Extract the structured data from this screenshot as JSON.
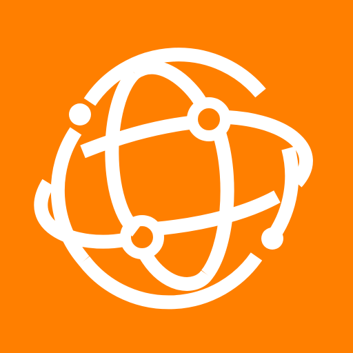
{
  "background_color": "#FF7F00",
  "icon": {
    "name": "network-globe-icon",
    "stroke_color": "#FFFFFF"
  }
}
